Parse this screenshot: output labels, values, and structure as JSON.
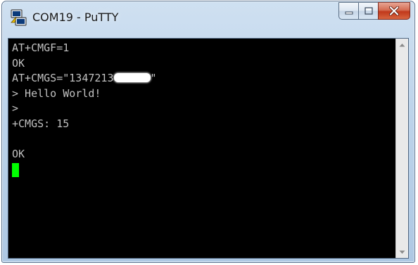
{
  "window": {
    "title": "COM19 - PuTTY",
    "icon": "putty-icon"
  },
  "caption_buttons": {
    "minimize_icon": "minimize-icon",
    "maximize_icon": "maximize-icon",
    "close_icon": "close-icon"
  },
  "terminal": {
    "background": "#000000",
    "foreground": "#c0c0c0",
    "cursor_color": "#00ff00",
    "lines": [
      "AT+CMGF=1",
      "OK",
      "AT+CMGS=\"1347213",
      "> Hello World!",
      ">",
      "+CMGS: 15",
      "",
      "OK"
    ],
    "line3_suffix": "\""
  },
  "scrollbar": {
    "up_icon": "scroll-up-arrow-icon",
    "down_icon": "scroll-down-arrow-icon"
  }
}
